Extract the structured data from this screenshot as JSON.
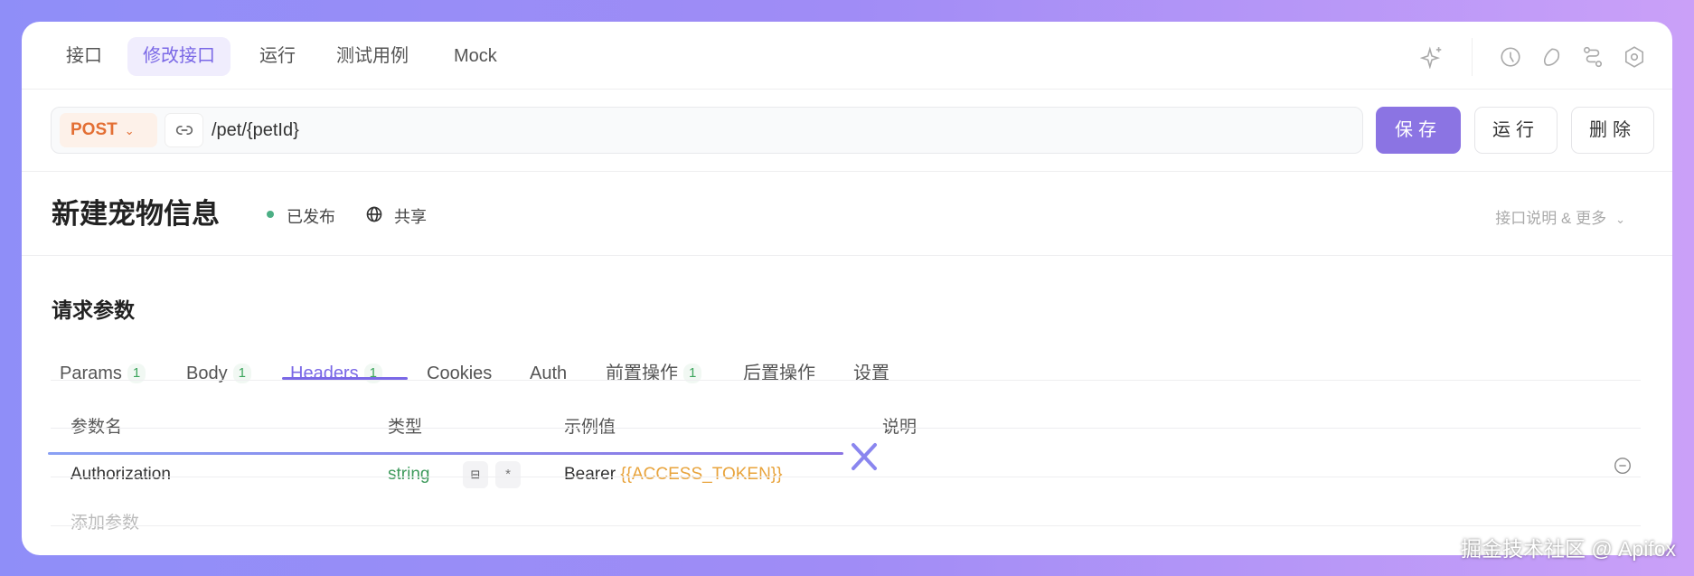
{
  "top_tabs": [
    {
      "label": "接口"
    },
    {
      "label": "修改接口"
    },
    {
      "label": "运行"
    },
    {
      "label": "测试用例"
    },
    {
      "label": "Mock"
    }
  ],
  "toolbar_icons": [
    "sparkle-icon",
    "history-icon",
    "shapes-icon",
    "workflow-icon",
    "settings-icon"
  ],
  "request": {
    "method": "POST",
    "path": "/pet/{petId}"
  },
  "actions": {
    "save": "保存",
    "run": "运行",
    "delete": "删除"
  },
  "endpoint": {
    "title": "新建宠物信息",
    "status": "已发布",
    "share": "共享",
    "more": "接口说明 & 更多"
  },
  "params": {
    "heading": "请求参数",
    "tabs": [
      {
        "label": "Params",
        "count": "1"
      },
      {
        "label": "Body",
        "count": "1"
      },
      {
        "label": "Headers",
        "count": "1"
      },
      {
        "label": "Cookies"
      },
      {
        "label": "Auth"
      },
      {
        "label": "前置操作",
        "count": "1"
      },
      {
        "label": "后置操作"
      },
      {
        "label": "设置"
      }
    ],
    "columns": [
      "参数名",
      "类型",
      "示例值",
      "说明"
    ],
    "rows": [
      {
        "name": "Authorization",
        "type": "string",
        "required": "*",
        "example_prefix": "Bearer ",
        "example_var": "{{ACCESS_TOKEN}}"
      }
    ],
    "add_placeholder": "添加参数"
  },
  "watermark": "掘金技术社区 @ Apifox",
  "colors": {
    "accent": "#7a68e6",
    "save": "#8b74e3",
    "method": "#e36f34",
    "published": "#4caf85",
    "type": "#3e9a5c",
    "variable": "#e8a33b"
  }
}
